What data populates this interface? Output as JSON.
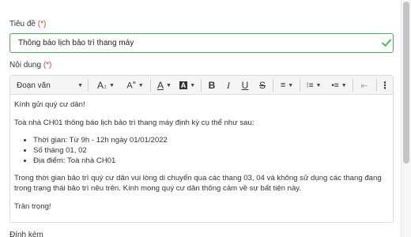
{
  "form": {
    "title_label": "Tiêu đề",
    "title_required": "(*)",
    "title_value": "Thông báo lịch bảo trì thang máy",
    "content_label": "Nội dung",
    "content_required": "(*)",
    "attach_label": "Đính kèm"
  },
  "toolbar": {
    "paragraph_format": "Đoạn văn",
    "icons": [
      "font-size-icon",
      "text-style-icon",
      "font-color-icon",
      "background-color-icon",
      "bold-icon",
      "italic-icon",
      "underline-icon",
      "strikethrough-icon",
      "align-icon",
      "numbered-list-icon",
      "bulleted-list-icon",
      "indent-icon",
      "more-options-icon"
    ]
  },
  "editor": {
    "greeting": "Kính gửi quý cư dân!",
    "intro": "Toà nhà CH01 thông báo lịch bảo trì thang máy định kỳ cụ thể như sau:",
    "items": [
      "Thời gian: Từ 9h - 12h ngày 01/01/2022",
      "Số tháng 01, 02",
      "Địa điểm: Toà nhà CH01"
    ],
    "notice": "Trong thời gian bảo trì quý cư dân vui lòng di chuyển qua các thang 03, 04 và không sử dụng các thang đang trong trạng thái bảo trì nêu trên. Kính mong quý cư dân thông cảm về sự bất tiện này.",
    "closing": "Trân trọng!"
  },
  "colors": {
    "valid_border": "#4caf50",
    "required": "#e53935"
  }
}
